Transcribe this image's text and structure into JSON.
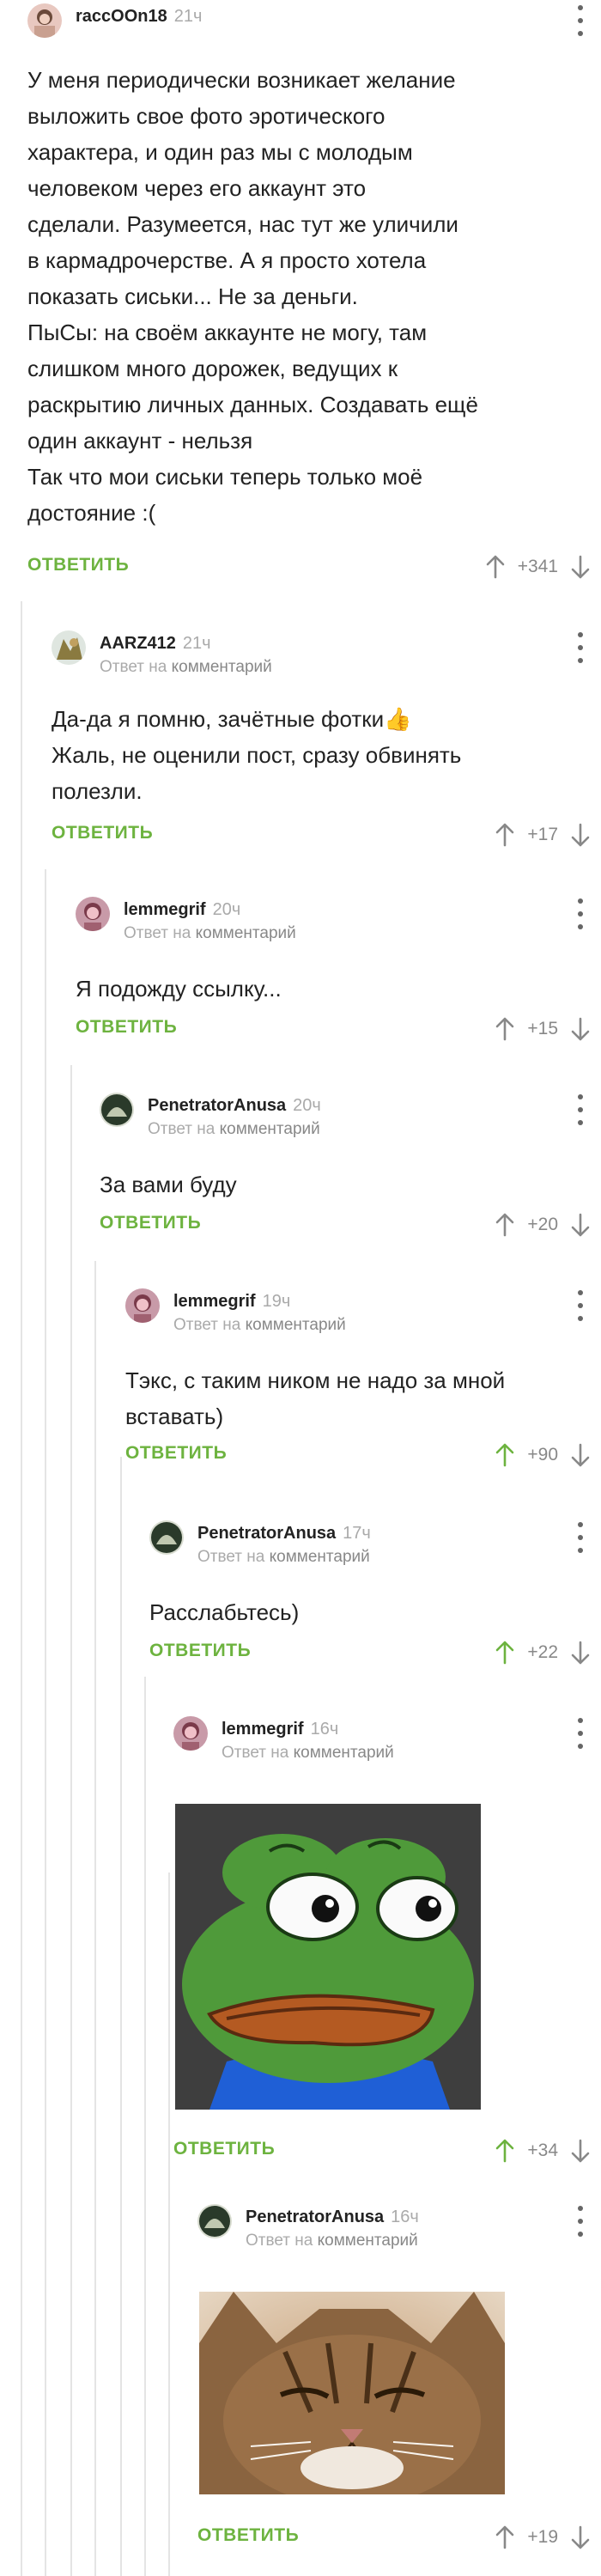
{
  "colors": {
    "accent": "#6db33f",
    "muted": "#aaaaaa",
    "text": "#222222"
  },
  "reply_on_word": "Ответ на",
  "reply_target_word": "комментарий",
  "reply_button": "ОТВЕТИТЬ",
  "comments": [
    {
      "author": "raccOOn18",
      "time": "21ч",
      "text": [
        "У меня периодически возникает желание",
        "выложить свое фото эротического",
        "характера, и один раз мы с молодым",
        "человеком через его аккаунт это",
        "сделали. Разумеется, нас тут же уличили",
        "в кармадрочерстве. А я просто хотела",
        "показать сиськи... Не за деньги.",
        "ПыСы: на своём аккаунте не могу, там",
        "слишком много дорожек, ведущих к",
        "раскрытию личных данных. Создавать ещё",
        "один аккаунт - нельзя",
        "Так что мои сиськи теперь только моё",
        "достояние :("
      ],
      "rating": "+341",
      "upvoted": false
    },
    {
      "author": "AARZ412",
      "time": "21ч",
      "text": [
        "Да-да я помню, зачётные фотки👍",
        "Жаль, не оценили пост, сразу обвинять",
        "полезли."
      ],
      "rating": "+17",
      "upvoted": false
    },
    {
      "author": "lemmegrif",
      "time": "20ч",
      "text": [
        "Я подожду ссылку..."
      ],
      "rating": "+15",
      "upvoted": false
    },
    {
      "author": "PenetratorAnusa",
      "time": "20ч",
      "text": [
        "За вами буду"
      ],
      "rating": "+20",
      "upvoted": false
    },
    {
      "author": "lemmegrif",
      "time": "19ч",
      "text": [
        "Тэкс, с таким ником не надо за мной",
        "вставать)"
      ],
      "rating": "+90",
      "upvoted": true
    },
    {
      "author": "PenetratorAnusa",
      "time": "17ч",
      "text": [
        "Расслабьтесь)"
      ],
      "rating": "+22",
      "upvoted": true
    },
    {
      "author": "lemmegrif",
      "time": "16ч",
      "image": "sad-frog-meme",
      "rating": "+34",
      "upvoted": true
    },
    {
      "author": "PenetratorAnusa",
      "time": "16ч",
      "image": "grumpy-cat-photo",
      "rating": "+19",
      "upvoted": false
    }
  ]
}
